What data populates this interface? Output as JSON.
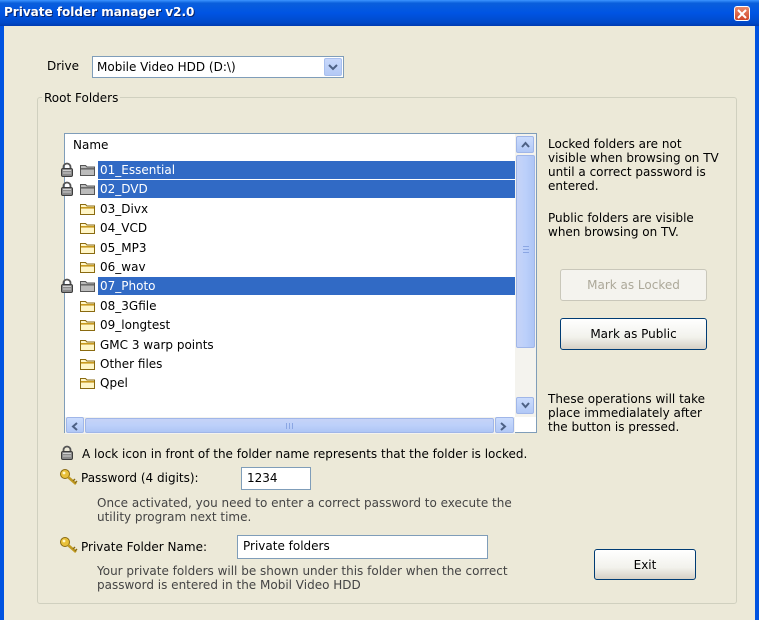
{
  "window": {
    "title": "Private folder manager v2.0"
  },
  "drive": {
    "label": "Drive",
    "value": "Mobile Video HDD (D:\\)"
  },
  "root_folders": {
    "legend": "Root Folders",
    "column_header": "Name",
    "folders": [
      {
        "name": "01_Essential",
        "locked": true,
        "selected": true
      },
      {
        "name": "02_DVD",
        "locked": true,
        "selected": true
      },
      {
        "name": "03_Divx",
        "locked": false,
        "selected": false
      },
      {
        "name": "04_VCD",
        "locked": false,
        "selected": false
      },
      {
        "name": "05_MP3",
        "locked": false,
        "selected": false
      },
      {
        "name": "06_wav",
        "locked": false,
        "selected": false
      },
      {
        "name": "07_Photo",
        "locked": true,
        "selected": true
      },
      {
        "name": "08_3Gfile",
        "locked": false,
        "selected": false
      },
      {
        "name": "09_longtest",
        "locked": false,
        "selected": false
      },
      {
        "name": "GMC 3 warp points",
        "locked": false,
        "selected": false
      },
      {
        "name": "Other files",
        "locked": false,
        "selected": false
      },
      {
        "name": "Qpel",
        "locked": false,
        "selected": false
      }
    ]
  },
  "info": {
    "locked_text": [
      "Locked folders are not",
      "visible when browsing on TV",
      "until a correct password is",
      "entered."
    ],
    "public_text": [
      "Public folders are visible",
      "when browsing on TV."
    ],
    "operations_text": [
      "These operations will take",
      "place immedialately after",
      "the button is pressed."
    ]
  },
  "buttons": {
    "mark_locked": "Mark as Locked",
    "mark_public": "Mark as Public",
    "exit": "Exit"
  },
  "lock_note": "A lock icon in front of the folder name represents that the folder is locked.",
  "password": {
    "label": "Password (4 digits):",
    "value": "1234",
    "note": [
      "Once activated, you need to enter a correct password to execute the",
      "utility program next time."
    ]
  },
  "private_folder": {
    "label": "Private Folder Name:",
    "value": "Private folders",
    "note": [
      "Your private folders will be shown under this folder when the correct",
      "password is entered in the Mobil Video HDD"
    ]
  },
  "colors": {
    "titlebar": "#0054e3",
    "selection": "#316ac5",
    "window_bg": "#ece9d8"
  },
  "icons": {
    "lock": "padlock-icon",
    "folder": "folder-icon",
    "key": "key-icon",
    "close": "close-icon"
  }
}
